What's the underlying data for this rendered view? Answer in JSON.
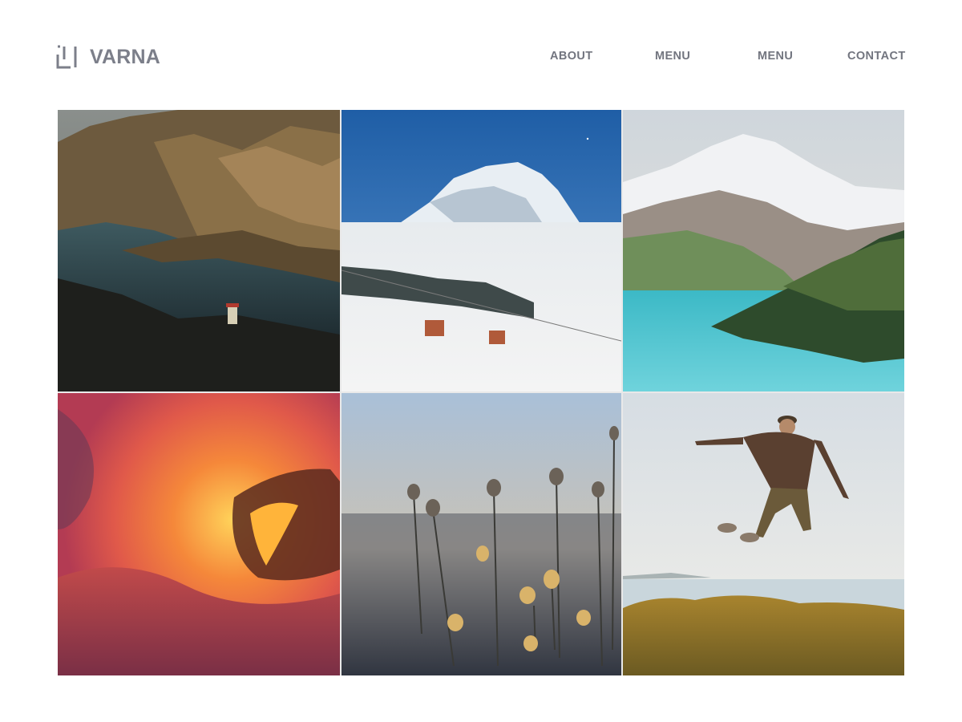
{
  "brand": {
    "name": "VARNA",
    "logo_icon": "square-bracket-logo-icon",
    "color": "#7c7f8a"
  },
  "nav": {
    "items": [
      {
        "label": "ABOUT"
      },
      {
        "label": "MENU"
      },
      {
        "label": "MENU"
      },
      {
        "label": "CONTACT"
      }
    ],
    "color": "#72757f"
  },
  "gallery": {
    "photos": [
      {
        "subject": "mountain lake canyon with pagoda"
      },
      {
        "subject": "snowy peak above clouds with cable cars"
      },
      {
        "subject": "snow mountain over turquoise lake"
      },
      {
        "subject": "lava flowing into the ocean"
      },
      {
        "subject": "backlit dandelion flowers"
      },
      {
        "subject": "man jumping on a coastal hill"
      }
    ]
  }
}
